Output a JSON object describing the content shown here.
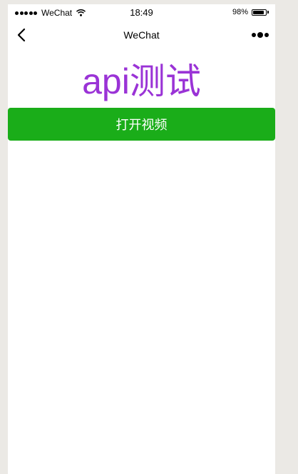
{
  "status_bar": {
    "carrier": "WeChat",
    "time": "18:49",
    "battery": "98%",
    "battery_level": 0.98
  },
  "nav": {
    "title": "WeChat",
    "back_icon": "chevron-left-icon",
    "more_icon": "more-dots-icon"
  },
  "main": {
    "heading": "api测试",
    "heading_color": "#9a33d6",
    "open_video_label": "打开视频",
    "button_color": "#1aad19"
  }
}
